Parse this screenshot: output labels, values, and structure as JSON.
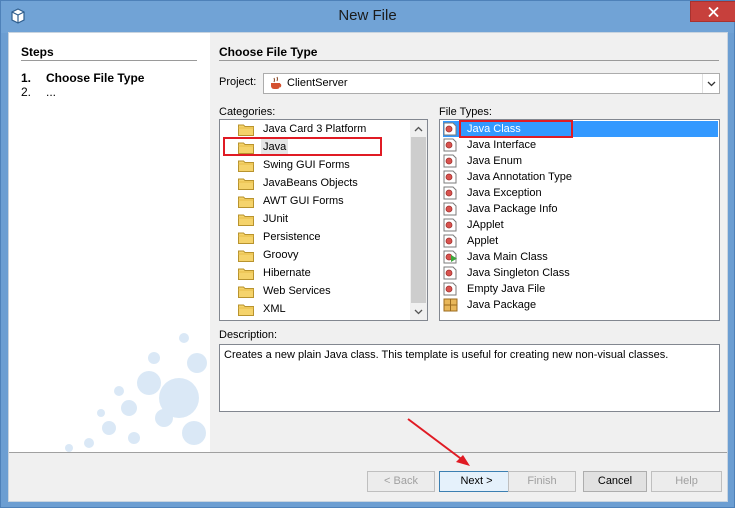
{
  "window": {
    "title": "New File"
  },
  "steps": {
    "title": "Steps",
    "items": [
      {
        "num": "1.",
        "label": "Choose File Type"
      },
      {
        "num": "2.",
        "label": "..."
      }
    ]
  },
  "main": {
    "section_title": "Choose File Type",
    "project_label": "Project:",
    "project_value": "ClientServer",
    "categories_label": "Categories:",
    "file_types_label": "File Types:",
    "categories": [
      "Java Card 3 Platform",
      "Java",
      "Swing GUI Forms",
      "JavaBeans Objects",
      "AWT GUI Forms",
      "JUnit",
      "Persistence",
      "Groovy",
      "Hibernate",
      "Web Services",
      "XML"
    ],
    "selected_category": "Java",
    "file_types": [
      {
        "label": "Java Class",
        "icon": "java-class-icon"
      },
      {
        "label": "Java Interface",
        "icon": "java-class-icon"
      },
      {
        "label": "Java Enum",
        "icon": "java-class-icon"
      },
      {
        "label": "Java Annotation Type",
        "icon": "java-class-icon"
      },
      {
        "label": "Java Exception",
        "icon": "java-class-icon"
      },
      {
        "label": "Java Package Info",
        "icon": "java-class-icon"
      },
      {
        "label": "JApplet",
        "icon": "java-class-icon"
      },
      {
        "label": "Applet",
        "icon": "java-class-icon"
      },
      {
        "label": "Java Main Class",
        "icon": "java-main-class-icon"
      },
      {
        "label": "Java Singleton Class",
        "icon": "java-class-icon"
      },
      {
        "label": "Empty Java File",
        "icon": "java-class-icon"
      },
      {
        "label": "Java Package",
        "icon": "package-icon"
      }
    ],
    "selected_file_type": "Java Class",
    "description_label": "Description:",
    "description": "Creates a new plain Java class. This template is useful for creating new non-visual classes."
  },
  "buttons": {
    "back": "< Back",
    "next": "Next >",
    "finish": "Finish",
    "cancel": "Cancel",
    "help": "Help"
  },
  "colors": {
    "titlebar": "#71a3d6",
    "selection": "#3399ff",
    "annotation_red": "#e01b24",
    "close_button": "#c7403c"
  }
}
